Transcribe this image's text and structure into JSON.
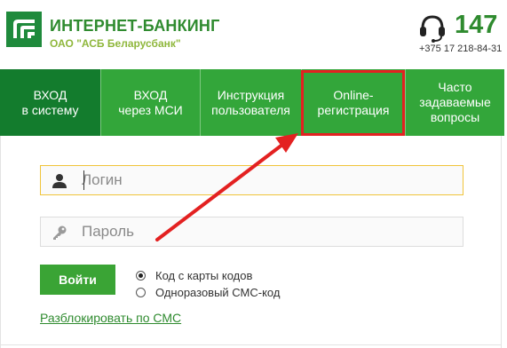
{
  "header": {
    "title": "ИНТЕРНЕТ-БАНКИНГ",
    "subtitle": "ОАО \"АСБ Беларусбанк\"",
    "hotline": "147",
    "phone": "+375 17 218-84-31",
    "icons": {
      "logo": "bank-logo-icon",
      "support": "headset-icon"
    }
  },
  "nav": {
    "items": [
      {
        "label": "ВХОД\nв систему",
        "active": true
      },
      {
        "label": "ВХОД\nчерез МСИ",
        "active": false
      },
      {
        "label": "Инструкция\nпользователя",
        "active": false
      },
      {
        "label": "Online-\nрегистрация",
        "active": false,
        "highlighted": true
      },
      {
        "label": "Часто\nзадаваемые\nвопросы",
        "active": false
      }
    ]
  },
  "form": {
    "login_placeholder": "Логин",
    "password_placeholder": "Пароль",
    "submit_label": "Войти",
    "auth_options": [
      {
        "label": "Код с карты кодов",
        "checked": true
      },
      {
        "label": "Одноразовый СМС-код",
        "checked": false
      }
    ],
    "unlock_link": "Разблокировать по СМС"
  },
  "colors": {
    "brand_green": "#2f8b2f",
    "nav_green": "#33a63a",
    "nav_active": "#137c2d",
    "annotation_red": "#e32121"
  }
}
